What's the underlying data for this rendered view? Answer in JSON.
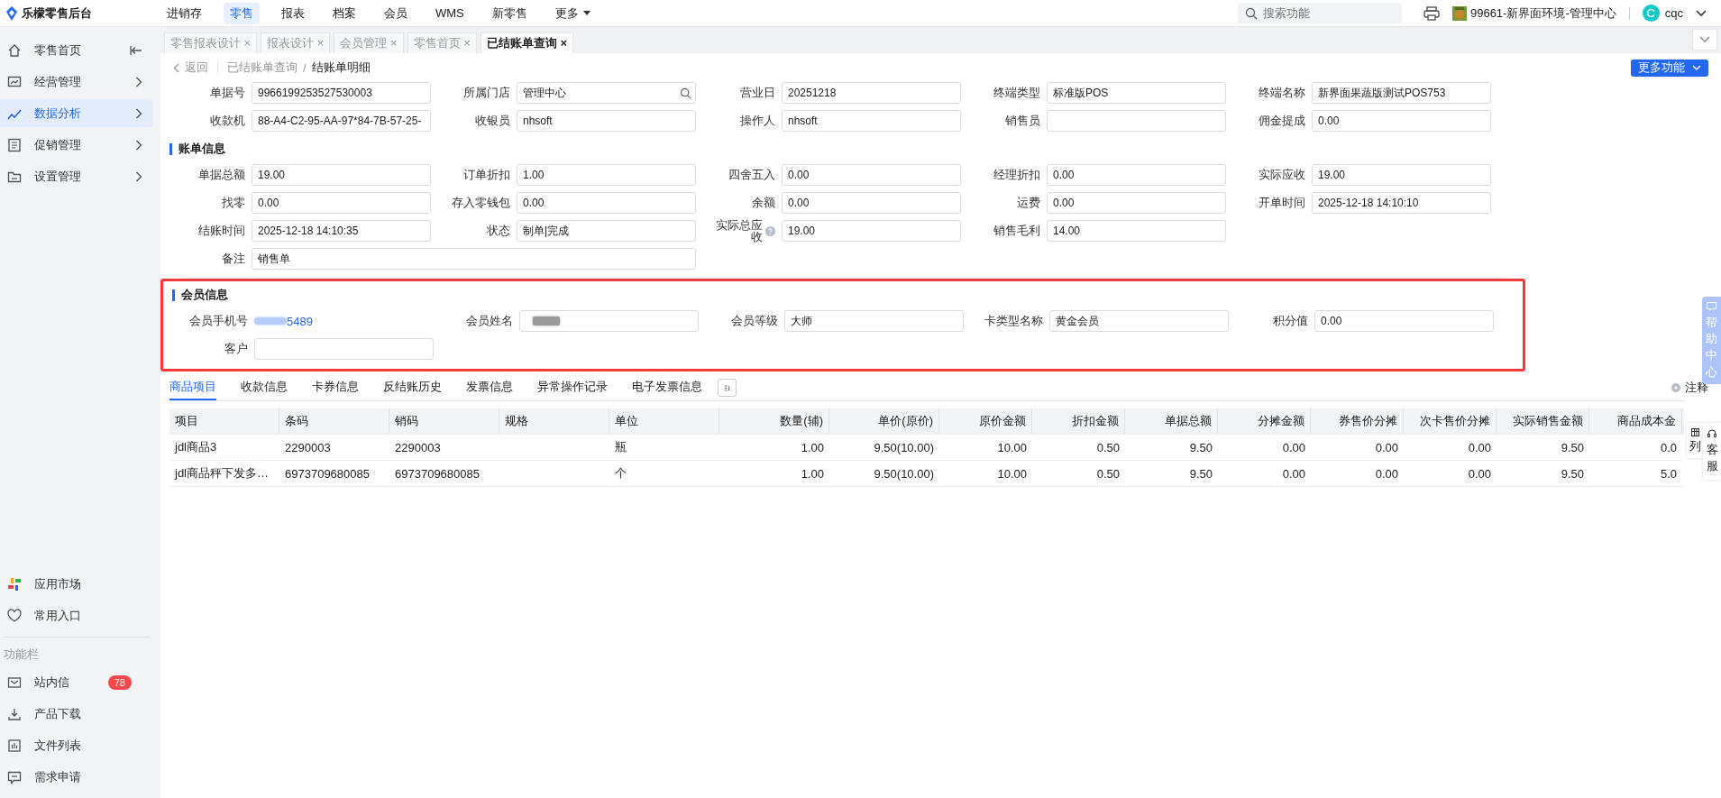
{
  "topbar": {
    "logo_text": "乐檬零售后台",
    "nav": [
      {
        "label": "进销存",
        "selected": false
      },
      {
        "label": "零售",
        "selected": true
      },
      {
        "label": "报表",
        "selected": false
      },
      {
        "label": "档案",
        "selected": false
      },
      {
        "label": "会员",
        "selected": false
      },
      {
        "label": "WMS",
        "selected": false
      },
      {
        "label": "新零售",
        "selected": false
      },
      {
        "label": "更多",
        "selected": false,
        "kind": "menu"
      }
    ],
    "search": {
      "placeholder": "搜索功能"
    },
    "store": "99661-新界面环境-管理中心",
    "avatar_letter": "C",
    "user": "cqc"
  },
  "sidebar": {
    "items": [
      {
        "label": "零售首页",
        "selected": false,
        "kind": "collapse"
      },
      {
        "label": "经营管理",
        "selected": false,
        "kind": "chevron"
      },
      {
        "label": "数据分析",
        "selected": true,
        "kind": "chevron"
      },
      {
        "label": "促销管理",
        "selected": false,
        "kind": "chevron"
      },
      {
        "label": "设置管理",
        "selected": false,
        "kind": "chevron"
      }
    ],
    "bottom_items": [
      {
        "label": "应用市场"
      },
      {
        "label": "常用入口"
      }
    ],
    "section_title": "功能栏",
    "tools": [
      {
        "label": "站内信",
        "badge": "78"
      },
      {
        "label": "产品下载"
      },
      {
        "label": "文件列表"
      },
      {
        "label": "需求申请"
      }
    ]
  },
  "tabs": [
    {
      "label": "零售报表设计",
      "selected": false
    },
    {
      "label": "报表设计",
      "selected": false
    },
    {
      "label": "会员管理",
      "selected": false
    },
    {
      "label": "零售首页",
      "selected": false
    },
    {
      "label": "已结账单查询",
      "selected": true
    }
  ],
  "tab_close": "×",
  "breadcrumb": {
    "back": "返回",
    "items": [
      "已结账单查询",
      "结账单明细"
    ],
    "separator": "/"
  },
  "more_button": "更多功能",
  "header_fields": [
    {
      "label": "单据号",
      "value": "9966199253527530003",
      "kind": "input"
    },
    {
      "label": "所属门店",
      "value": "管理中心",
      "kind": "search"
    },
    {
      "label": "营业日",
      "value": "20251218",
      "kind": "input"
    },
    {
      "label": "终端类型",
      "value": "标准版POS",
      "kind": "input"
    },
    {
      "label": "终端名称",
      "value": "新界面果蔬版测试POS753",
      "kind": "input"
    },
    {
      "label": "收款机",
      "value": "88-A4-C2-95-AA-97*84-7B-57-25-",
      "kind": "input"
    },
    {
      "label": "收银员",
      "value": "nhsoft",
      "kind": "input"
    },
    {
      "label": "操作人",
      "value": "nhsoft",
      "kind": "input"
    },
    {
      "label": "销售员",
      "kind": "input"
    },
    {
      "label": "佣金提成",
      "value": "0.00",
      "kind": "input"
    }
  ],
  "bill_section": {
    "title": "账单信息",
    "fields": [
      {
        "label": "单据总额",
        "value": "19.00",
        "kind": "input"
      },
      {
        "label": "订单折扣",
        "value": "1.00",
        "kind": "input"
      },
      {
        "label": "四舍五入",
        "value": "0.00",
        "kind": "input"
      },
      {
        "label": "经理折扣",
        "value": "0.00",
        "kind": "input"
      },
      {
        "label": "实际应收",
        "value": "19.00",
        "kind": "input"
      },
      {
        "label": "找零",
        "value": "0.00",
        "kind": "input"
      },
      {
        "label": "存入零钱包",
        "value": "0.00",
        "kind": "input"
      },
      {
        "label": "余额",
        "value": "0.00",
        "kind": "input"
      },
      {
        "label": "运费",
        "value": "0.00",
        "kind": "input"
      },
      {
        "label": "开单时间",
        "value": "2025-12-18 14:10:10",
        "kind": "input"
      },
      {
        "label": "结账时间",
        "value": "2025-12-18 14:10:35",
        "kind": "input"
      },
      {
        "label": "状态",
        "value": "制单|完成",
        "kind": "input"
      },
      {
        "label": "实际总应收",
        "value": "19.00",
        "kind": "help"
      },
      {
        "label": "销售毛利",
        "value": "14.00",
        "kind": "input"
      },
      {
        "label": "备注",
        "value": "销售单",
        "kind": "wide"
      }
    ]
  },
  "member_section": {
    "title": "会员信息",
    "highlighted": true,
    "fields": [
      {
        "label": "会员手机号",
        "value": "5489",
        "kind": "link",
        "masked": true
      },
      {
        "label": "会员姓名",
        "kind": "input",
        "masked": true
      },
      {
        "label": "会员等级",
        "value": "大师",
        "kind": "input",
        "masked": false
      },
      {
        "label": "卡类型名称",
        "value": "黄金会员",
        "kind": "input",
        "masked": false
      },
      {
        "label": "积分值",
        "value": "0.00",
        "kind": "input",
        "masked": false
      },
      {
        "label": "客户",
        "kind": "input",
        "masked": false
      }
    ]
  },
  "detail_tabs": [
    {
      "label": "商品项目",
      "selected": true
    },
    {
      "label": "收款信息",
      "selected": false
    },
    {
      "label": "卡券信息",
      "selected": false
    },
    {
      "label": "反结账历史",
      "selected": false
    },
    {
      "label": "发票信息",
      "selected": false
    },
    {
      "label": "异常操作记录",
      "selected": false
    },
    {
      "label": "电子发票信息",
      "selected": false
    }
  ],
  "note": "注释",
  "table": {
    "columns": [
      "项目",
      "条码",
      "销码",
      "规格",
      "单位",
      "数量(辅)",
      "单价(原价)",
      "原价金额",
      "折扣金额",
      "单据总额",
      "分摊金额",
      "券售价分摊",
      "次卡售价分摊",
      "实际销售金额",
      "商品成本金"
    ],
    "rows": [
      [
        "jdl商品3",
        "2290003",
        "2290003",
        "",
        "瓶",
        "1.00",
        "9.50(10.00)",
        "10.00",
        "0.50",
        "9.50",
        "0.00",
        "0.00",
        "0.00",
        "9.50",
        "0.0"
      ],
      [
        "jdl商品秤下发多…",
        "6973709680085",
        "6973709680085",
        "",
        "个",
        "1.00",
        "9.50(10.00)",
        "10.00",
        "0.50",
        "9.50",
        "0.00",
        "0.00",
        "0.00",
        "9.50",
        "5.0"
      ]
    ]
  },
  "side_tabs": {
    "help": "帮助中心",
    "columns": "列",
    "service": "客服"
  }
}
